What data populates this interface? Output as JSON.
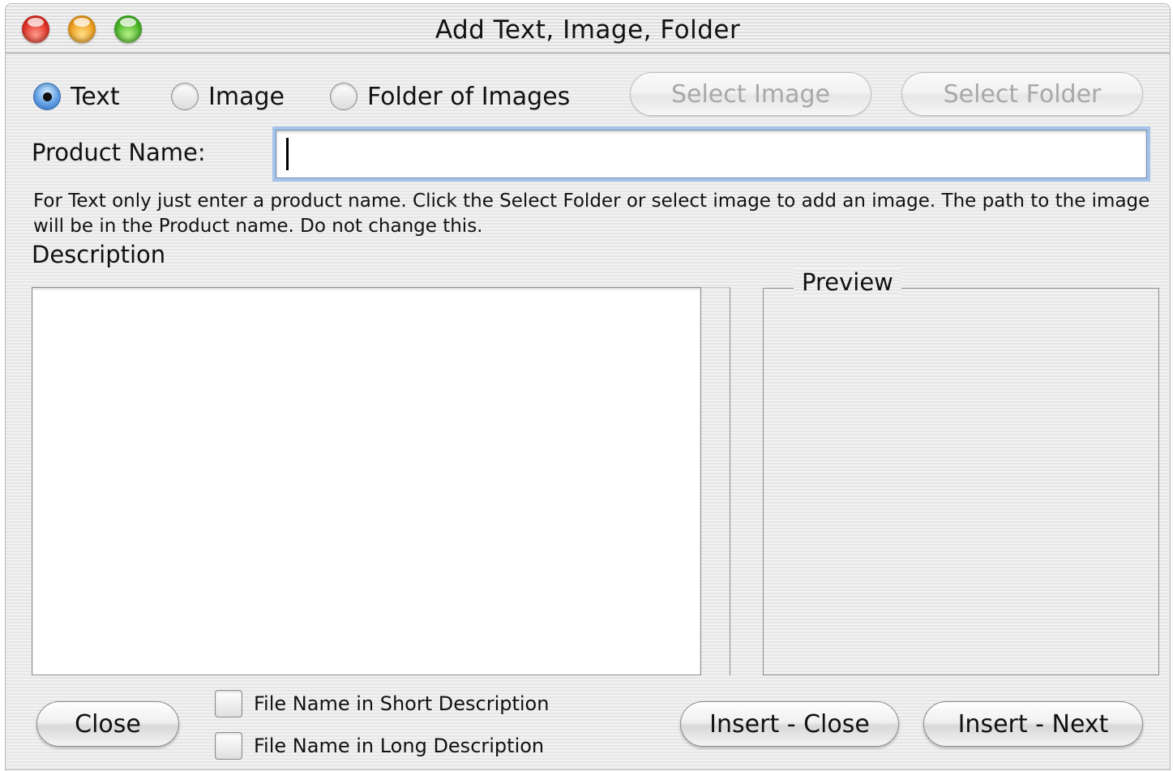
{
  "window": {
    "title": "Add Text, Image, Folder"
  },
  "mode": {
    "options": [
      {
        "label": "Text",
        "checked": true
      },
      {
        "label": "Image",
        "checked": false
      },
      {
        "label": "Folder of Images",
        "checked": false
      }
    ]
  },
  "toolbar": {
    "select_image_label": "Select Image",
    "select_folder_label": "Select Folder"
  },
  "product": {
    "label": "Product Name:",
    "value": "",
    "help_text": "For Text only just enter a product name. Click the Select Folder or select image to add an image. The path to the image will be in the Product name. Do not change this."
  },
  "description": {
    "label": "Description",
    "value": ""
  },
  "preview": {
    "title": "Preview"
  },
  "options": {
    "short_description_label": "File Name in Short Description",
    "short_description_checked": false,
    "long_description_label": "File Name in Long Description",
    "long_description_checked": false
  },
  "actions": {
    "close_label": "Close",
    "insert_close_label": "Insert - Close",
    "insert_next_label": "Insert - Next"
  }
}
